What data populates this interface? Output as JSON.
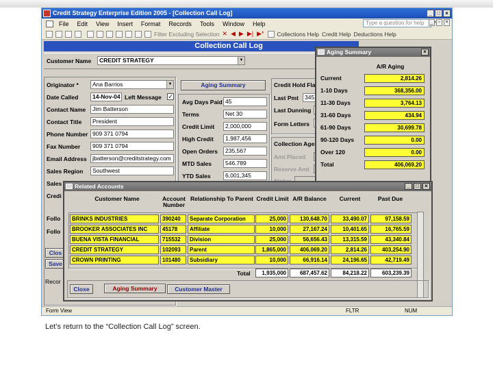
{
  "window": {
    "title": "Credit Strategy Enterprise Edition 2005 - [Collection Call Log]",
    "help_placeholder": "Type a question for help"
  },
  "menus": [
    "File",
    "Edit",
    "View",
    "Insert",
    "Format",
    "Records",
    "Tools",
    "Window",
    "Help"
  ],
  "toolbar": {
    "filter_label": "Filter Excluding Selection",
    "collections_help": "Collections Help",
    "credit_help": "Credit Help",
    "deductions_help": "Deductions Help"
  },
  "form": {
    "title": "Collection Call Log",
    "customer_name_label": "Customer Name",
    "customer_name": "CREDIT STRATEGY",
    "left": {
      "originator_label": "Originator *",
      "originator": "Ana Barrios",
      "date_called_label": "Date Called",
      "date_called": "14-Nov-04",
      "left_message_label": "Left Message",
      "left_message_checked": "✓",
      "contact_name_label": "Contact Name",
      "contact_name": "Jim Batterson",
      "contact_title_label": "Contact Title",
      "contact_title": "President",
      "phone_label": "Phone Number",
      "phone": "909 371 0794",
      "fax_label": "Fax Number",
      "fax": "909 371 0794",
      "email_label": "Email Address",
      "email": "jbatterson@creditstrategy.com",
      "region_label": "Sales Region",
      "region": "Southwest",
      "sales_partial": "Sales",
      "credit_partial": "Credi",
      "follow1_partial": "Follo",
      "follow2_partial": "Follo",
      "close_partial": "Clos",
      "save_partial": "Save",
      "record_partial": "Recor"
    },
    "middle": {
      "aging_button": "Aging Summary",
      "avg_days_label": "Avg Days Paid",
      "avg_days": "45",
      "terms_label": "Terms",
      "terms": "Net 30",
      "credit_limit_label": "Credit Limit",
      "credit_limit": "2,000,000",
      "high_credit_label": "High Credit",
      "high_credit": "1,987,456",
      "open_orders_label": "Open Orders",
      "open_orders": "235,567",
      "mtd_label": "MTD Sales",
      "mtd": "546.789",
      "ytd_label": "YTD Sales",
      "ytd": "6,001,345"
    },
    "right": {
      "credit_hold_label": "Credit Hold Flag",
      "last_pmt_label": "Last Pmt",
      "last_pmt": "345,",
      "last_dunning_label": "Last Dunning",
      "form_letters_label": "Form Letters",
      "collection_agency_label": "Collection Agency",
      "amt_placed_label": "Amt Placed",
      "reserve_amt_label": "Reserve Amt",
      "status_label": "Status"
    }
  },
  "aging": {
    "title": "Aging Summary",
    "header": "A/R Aging",
    "rows": [
      {
        "label": "Current",
        "value": "2,814.26"
      },
      {
        "label": "1-10 Days",
        "value": "368,356.00"
      },
      {
        "label": "11-30 Days",
        "value": "3,764.13"
      },
      {
        "label": "31-60 Days",
        "value": "434.94"
      },
      {
        "label": "61-90 Days",
        "value": "30,699.78"
      },
      {
        "label": "90-120 Days",
        "value": "0.00"
      },
      {
        "label": "Over 120",
        "value": "0.00"
      },
      {
        "label": "Total",
        "value": "406,069.20"
      }
    ]
  },
  "related": {
    "title": "Related Accounts",
    "headers": {
      "customer": "Customer Name",
      "account": "Account Number",
      "relationship": "Relationship To Parent",
      "credit_limit": "Credit Limit",
      "ar_balance": "A/R Balance",
      "current": "Current",
      "past_due": "Past Due"
    },
    "rows": [
      [
        "BRINKS INDUSTRIES",
        "390240",
        "Separate Corporation",
        "25,000",
        "130,648.70",
        "33,490.07",
        "97,158.59"
      ],
      [
        "BROOKER ASSOCIATES INC",
        "45178",
        "Affiliate",
        "10,000",
        "27,167.24",
        "10,401.65",
        "16,765.59"
      ],
      [
        "BUENA VISTA FINANCIAL",
        "715532",
        "Division",
        "25,000",
        "56,656.43",
        "13,315.59",
        "43,340.84"
      ],
      [
        "CREDIT STRATEGY",
        "102093",
        "Parent",
        "1,865,000",
        "406,069.20",
        "2,814.26",
        "403,254.90"
      ],
      [
        "CROWN PRINTING",
        "101480",
        "Subsidiary",
        "10,000",
        "66,916.14",
        "24,196.65",
        "42,719.49"
      ]
    ],
    "total_label": "Total",
    "totals": [
      "1,935,000",
      "687,457.62",
      "84,218.22",
      "603,239.39"
    ],
    "buttons": {
      "close": "Close",
      "aging": "Aging Summary",
      "customer_master": "Customer Master"
    }
  },
  "statusbar": {
    "view": "Form View",
    "filter": "FLTR",
    "num": "NUM"
  },
  "caption": "Let’s return to the “Collection Call Log” screen."
}
